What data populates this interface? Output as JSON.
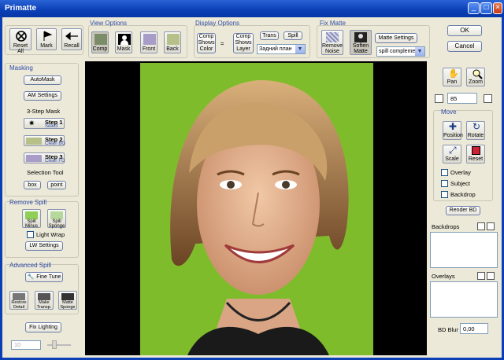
{
  "window": {
    "title": "Primatte"
  },
  "toolbar_left": {
    "reset_all": "Reset All",
    "mark": "Mark",
    "recall": "Recall"
  },
  "view_options": {
    "title": "View Options",
    "comp": "Comp",
    "mask": "Mask",
    "front": "Front",
    "back": "Back"
  },
  "display_options": {
    "title": "Display Options",
    "comp_shows_color": "Comp Shows Color",
    "comp_shows_layer": "Comp Shows Layer",
    "trans": "Trans",
    "spill": "Spill",
    "layer_select": "Задний план",
    "separator": "="
  },
  "fix_matte": {
    "title": "Fix Matte",
    "remove_noise": "Remove Noise",
    "soften_matte": "Soften Matte",
    "matte_settings": "Matte Settings",
    "spill_select": "spill complement"
  },
  "dialog": {
    "ok": "OK",
    "cancel": "Cancel"
  },
  "masking": {
    "title": "Masking",
    "automask": "AutoMask",
    "am_settings": "AM Settings",
    "three_step": "3-Step Mask",
    "step1_title": "Step 1",
    "step1_sub": "Select",
    "step2_title": "Step 2",
    "step2_sub": "Clean BG",
    "step3_title": "Step 3",
    "step3_sub": "Clean FG",
    "selection_tool": "Selection Tool",
    "box": "box",
    "point": "point"
  },
  "remove_spill": {
    "title": "Remove Spill",
    "spill_minus": "Spill Minus",
    "spill_sponge": "Spill Sponge",
    "light_wrap": "Light Wrap",
    "lw_settings": "LW Settings"
  },
  "advanced_spill": {
    "title": "Advanced Spill",
    "fine_tune": "Fine Tune",
    "restore_detail": "Restore Detail",
    "make_transp": "Make Transp.",
    "matte_sponge": "Matte Sponge"
  },
  "bottom_left": {
    "fix_lighting": "Fix Lighting",
    "slider_value": "10"
  },
  "view_tools": {
    "pan": "Pan",
    "zoom": "Zoom",
    "zoom_value": "85"
  },
  "move": {
    "title": "Move",
    "position": "Position",
    "rotate": "Rotate",
    "scale": "Scale",
    "reset": "Reset",
    "overlay": "Overlay",
    "subject": "Subject",
    "backdrop": "Backdrop",
    "render_bd": "Render BD"
  },
  "backdrops": {
    "title": "Backdrops"
  },
  "overlays": {
    "title": "Overlays"
  },
  "bd_blur": {
    "label": "BD Blur",
    "value": "0,00"
  },
  "colors": {
    "green_screen": "#7fbc2c",
    "viewer_bg": "#000000",
    "title_bar": "#0a3fb5",
    "group_title": "#2f4ca8"
  }
}
